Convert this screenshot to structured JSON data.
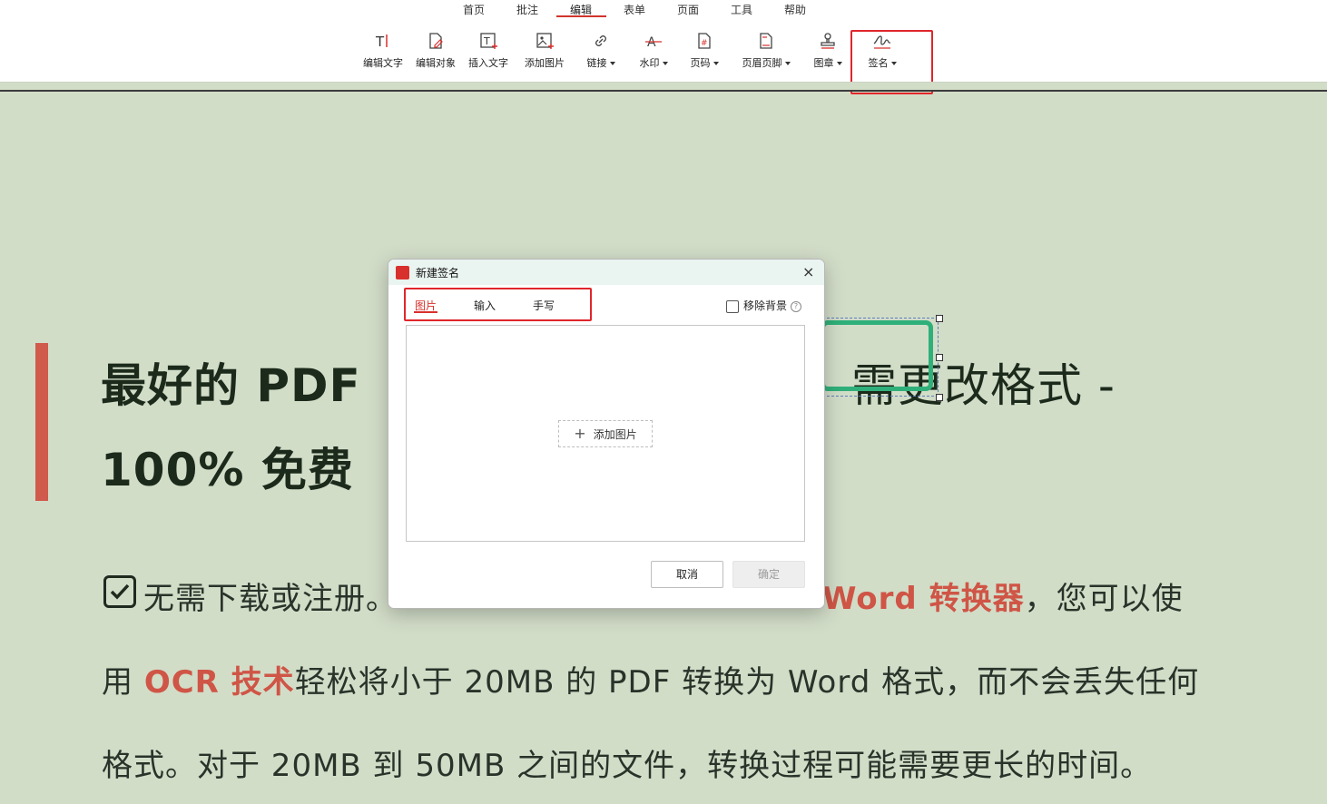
{
  "menu": {
    "items": [
      "首页",
      "批注",
      "编辑",
      "表单",
      "页面",
      "工具",
      "帮助"
    ],
    "active": "编辑"
  },
  "toolbar": {
    "edit_text": "编辑文字",
    "edit_object": "编辑对象",
    "insert_text": "插入文字",
    "add_image": "添加图片",
    "link": "链接",
    "watermark": "水印",
    "page_number": "页码",
    "header_footer": "页眉页脚",
    "stamp": "图章",
    "signature": "签名"
  },
  "document": {
    "headline_line1_left": "最好的 PDF",
    "headline_line1_right": "需更改格式 -",
    "headline_line2": "100% 免费",
    "para_line1_left": "无需下载或注册。",
    "para_line1_red": "Word 转换器",
    "para_line1_right": "，您可以使",
    "para_line2_pre": "用 ",
    "para_line2_red": "OCR 技术",
    "para_line2_post": "轻松将小于 20MB 的 PDF 转换为 Word 格式，而不会丢失任何",
    "para_line3": "格式。对于 20MB 到 50MB 之间的文件，转换过程可能需要更长的时间。"
  },
  "dialog": {
    "title": "新建签名",
    "close": "×",
    "tabs": [
      "图片",
      "输入",
      "手写"
    ],
    "active_tab": "图片",
    "remove_background": "移除背景",
    "add_image_button": "添加图片",
    "cancel": "取消",
    "confirm": "确定"
  },
  "colors": {
    "accent_red": "#d8302d",
    "doc_background": "#d2ddc8",
    "highlight_red": "#cf5546",
    "signature_green": "#2fb07a"
  }
}
